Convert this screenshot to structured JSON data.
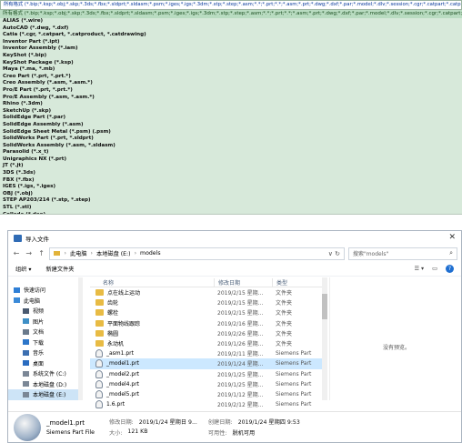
{
  "formats": {
    "header": "所有格式 (*.bip;*.ksp;*.obj;*.skp;*.3ds;*.fbx;*.sldprt;*.sldasm;*.psm;*.iges;*.igs;*.3dm;*.stp;*.step;*.asm;*.*;*.prt;*.*;*.asm;*.prt;*.dwg;*.dxf;*.par;*.model;*.dlv;*.session;*.cgr;*.catpart;*.catproduct;*.catdrawing",
    "selected": "所有格式 (*.bip;*.ksp;*.obj;*.skp;*.3ds;*.fbx;*.sldprt;*.sldasm;*.psm;*.iges;*.igs;*.3dm;*.stp;*.step;*.asm;*.*;*.prt;*.*;*.asm;*.prt;*.dwg;*.dxf;*.par;*.model;*.dlv;*.session;*.cgr;*.catpart;*.catproduct;*.catdrawing",
    "items": [
      "ALIAS (*.wire)",
      "AutoCAD (*.dwg, *.dxf)",
      "Catia (*.cgr, *.catpart, *.catproduct, *.catdrawing)",
      "Inventor Part (*.ipt)",
      "Inventor Assembly (*.iam)",
      "KeyShot (*.bip)",
      "KeyShot Package (*.ksp)",
      "Maya (*.ma, *.mb)",
      "Creo Part (*.prt, *.prt.*)",
      "Creo Assembly (*.asm, *.asm.*)",
      "Pro/E Part (*.prt, *.prt.*)",
      "Pro/E Assembly (*.asm, *.asm.*)",
      "Rhino (*.3dm)",
      "SketchUp (*.skp)",
      "SolidEdge Part (*.par)",
      "SolidEdge Assembly (*.asm)",
      "SolidEdge Sheet Metal (*.psm) (.psm)",
      "SolidWorks Part (*.prt, *.sldprt)",
      "SolidWorks Assembly (*.asm, *.sldasm)",
      "Parasolid (*.x_t)",
      "Unigraphics NX (*.prt)",
      "JT (*.jt)",
      "3DS (*.3ds)",
      "FBX (*.fbx)",
      "IGES (*.igs, *.iges)",
      "OBJ (*.obj)",
      "STEP AP203/214 (*.stp, *.step)",
      "STL (*.stl)",
      "Collada (*.dae)"
    ]
  },
  "dialog": {
    "title": "导入文件",
    "close": "✕",
    "nav": {
      "back": "←",
      "forward": "→",
      "up": "↑"
    },
    "breadcrumb": [
      "此电脑",
      "本地磁盘 (E:)",
      "models"
    ],
    "search_placeholder": "搜索\"models\"",
    "toolbar": {
      "organize": "组织 ▾",
      "new_folder": "新建文件夹",
      "help": "?"
    },
    "sidebar": [
      {
        "label": "快速访问",
        "icon": "star-icon"
      },
      {
        "label": "此电脑",
        "icon": "computer-icon"
      },
      {
        "label": "视频",
        "icon": "video-icon"
      },
      {
        "label": "图片",
        "icon": "picture-icon"
      },
      {
        "label": "文档",
        "icon": "document-icon"
      },
      {
        "label": "下载",
        "icon": "download-icon"
      },
      {
        "label": "音乐",
        "icon": "music-icon"
      },
      {
        "label": "桌面",
        "icon": "desktop-icon"
      },
      {
        "label": "系统文件 (C:)",
        "icon": "drive-icon"
      },
      {
        "label": "本地磁盘 (D:)",
        "icon": "drive-icon"
      },
      {
        "label": "本地磁盘 (E:)",
        "icon": "drive-icon"
      }
    ],
    "columns": {
      "name": "名称",
      "date": "修改日期",
      "type": "类型"
    },
    "files": [
      {
        "name": "点在线上运动",
        "date": "2019/2/15 星期...",
        "type": "文件夹",
        "kind": "folder"
      },
      {
        "name": "齿轮",
        "date": "2019/2/15 星期...",
        "type": "文件夹",
        "kind": "folder"
      },
      {
        "name": "螺栓",
        "date": "2019/2/15 星期...",
        "type": "文件夹",
        "kind": "folder"
      },
      {
        "name": "平面物线跟踪",
        "date": "2019/2/16 星期...",
        "type": "文件夹",
        "kind": "folder"
      },
      {
        "name": "椭圆",
        "date": "2019/2/26 星期...",
        "type": "文件夹",
        "kind": "folder"
      },
      {
        "name": "永动机",
        "date": "2019/1/26 星期...",
        "type": "文件夹",
        "kind": "folder"
      },
      {
        "name": "_asm1.prt",
        "date": "2019/2/11 星期...",
        "type": "Siemens Part",
        "kind": "file"
      },
      {
        "name": "_model1.prt",
        "date": "2019/1/24 星期...",
        "type": "Siemens Part",
        "kind": "file"
      },
      {
        "name": "_model2.prt",
        "date": "2019/1/25 星期...",
        "type": "Siemens Part",
        "kind": "file"
      },
      {
        "name": "_model4.prt",
        "date": "2019/1/25 星期...",
        "type": "Siemens Part",
        "kind": "file"
      },
      {
        "name": "_model5.prt",
        "date": "2019/1/12 星期...",
        "type": "Siemens Part",
        "kind": "file"
      },
      {
        "name": "1.6.prt",
        "date": "2019/2/12 星期...",
        "type": "Siemens Part",
        "kind": "file"
      }
    ],
    "preview_text": "没有预览。",
    "details": {
      "filename": "_model1.prt",
      "filetype": "Siemens Part File",
      "modified_label": "修改日期:",
      "modified_value": "2019/1/24 星期日 9...",
      "size_label": "大小:",
      "size_value": "121 KB",
      "created_label": "创建日期:",
      "created_value": "2019/1/24 星期四 9:53",
      "availability_label": "可用性:",
      "availability_value": "脱机可用"
    }
  }
}
